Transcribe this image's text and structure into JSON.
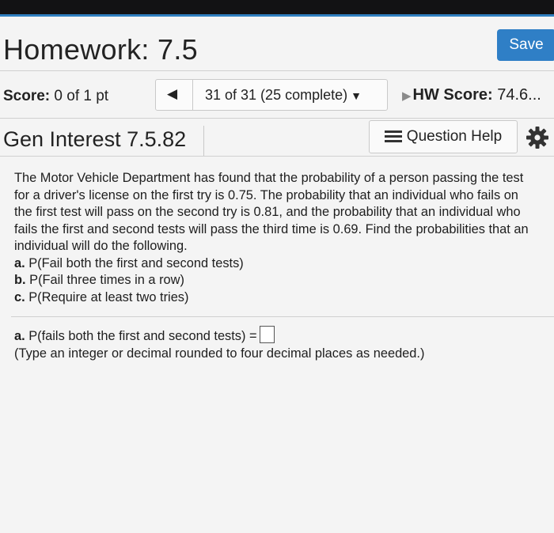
{
  "header": {
    "title": "Homework: 7.5",
    "save_label": "Save"
  },
  "score": {
    "label": "Score:",
    "value": "0 of 1 pt"
  },
  "nav": {
    "prev_icon": "triangle-left",
    "position_text": "31 of 31 (25 complete)",
    "dropdown_icon": "triangle-down"
  },
  "hw_score": {
    "label": "HW Score:",
    "value": "74.6..."
  },
  "question": {
    "name": "Gen Interest 7.5.82",
    "help_label": "Question Help",
    "help_icon": "list-icon",
    "settings_icon": "gear-icon",
    "text": "The Motor Vehicle Department has found that the probability of a person passing the test for a driver's license on the first try is 0.75. The probability that an individual who fails on the first test will pass on the second try is 0.81, and the probability that an individual who fails the first and second tests will pass the third time is 0.69. Find the probabilities that an individual will do the following.",
    "parts": [
      {
        "letter": "a.",
        "text": "P(Fail both the first and second tests)"
      },
      {
        "letter": "b.",
        "text": "P(Fail three times in a row)"
      },
      {
        "letter": "c.",
        "text": "P(Require at least two tries)"
      }
    ]
  },
  "answer": {
    "letter": "a.",
    "prompt": "P(fails both the first and second tests) =",
    "value": "",
    "instruction": "(Type an integer or decimal rounded to four decimal places as needed.)"
  },
  "colors": {
    "accent": "#2f7fc6",
    "background": "#f4f4f4"
  }
}
